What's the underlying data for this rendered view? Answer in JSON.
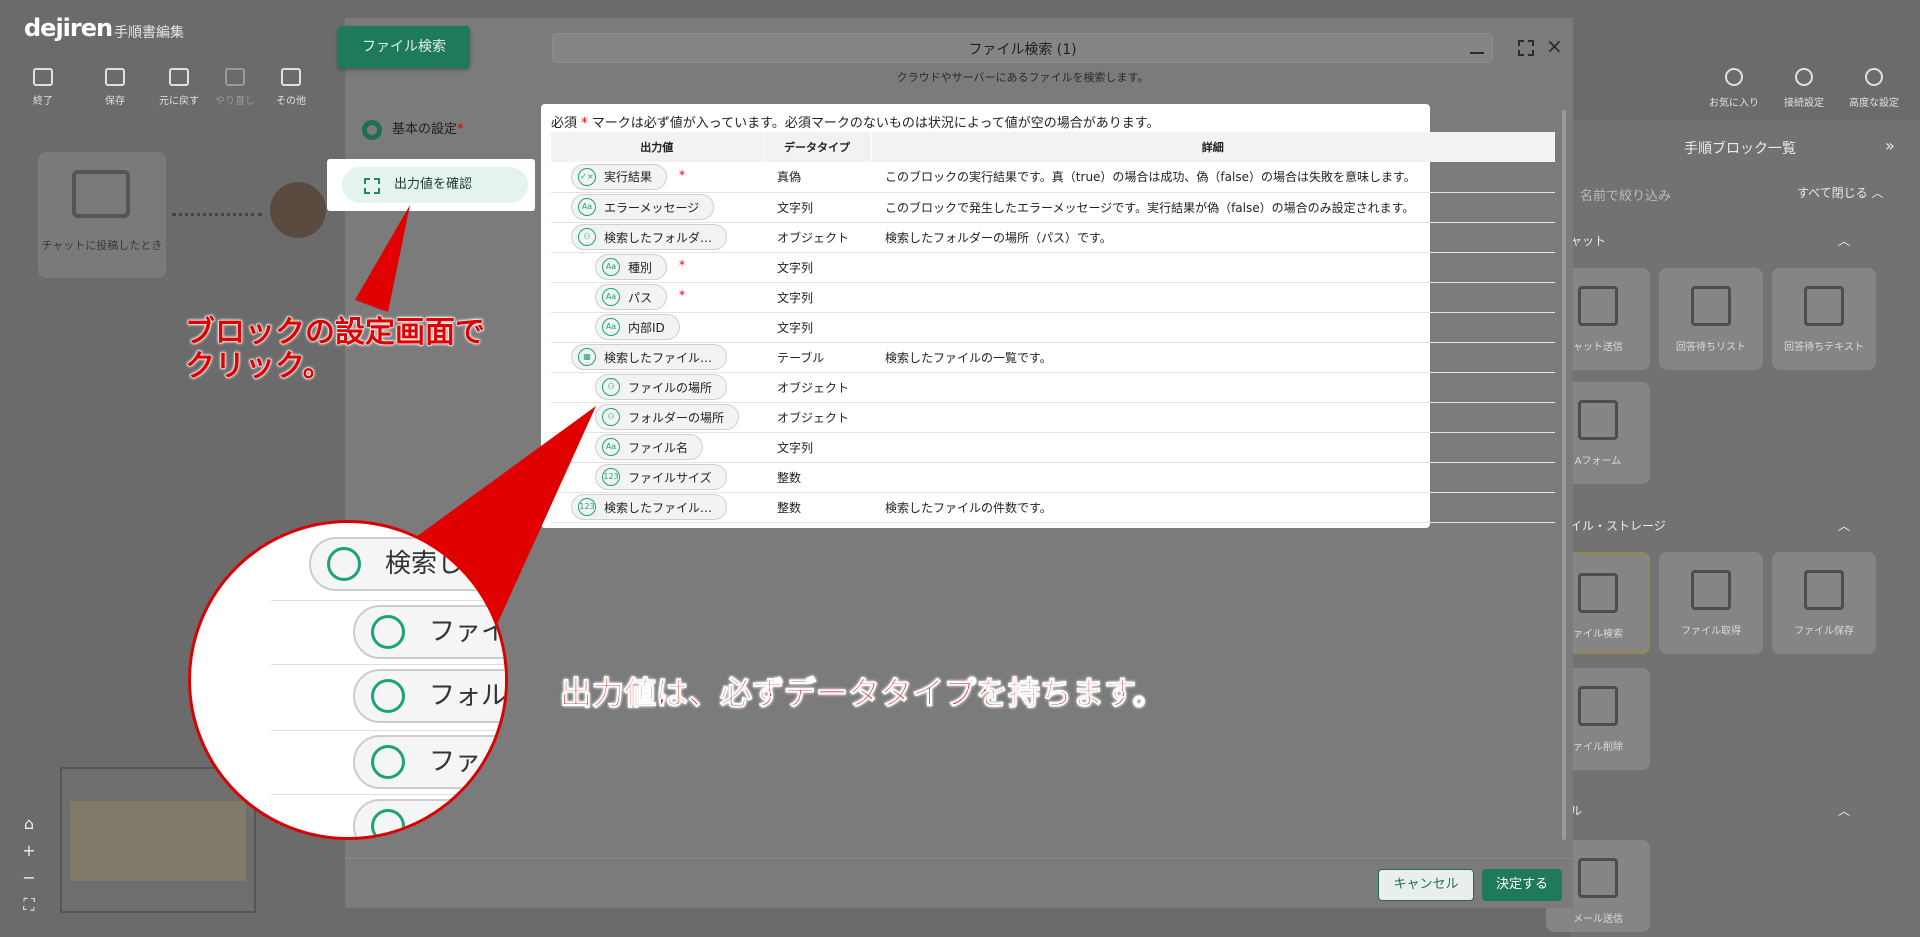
{
  "app": {
    "logo": "dejiren",
    "document_title": "手順書編集",
    "toolbar": [
      "終了",
      "保存",
      "元に戻す",
      "やり直し",
      "その他"
    ],
    "canvas_card_label": "チャットに投稿したとき",
    "right_tools": [
      "お気に入り",
      "接続設定",
      "高度な設定"
    ]
  },
  "right_panel": {
    "title": "手順ブロック一覧",
    "filter_placeholder": "名前で絞り込み",
    "close_all": "すべて閉じる",
    "sections": [
      {
        "label": "ャット",
        "cards": [
          "ャット送信",
          "回答待ちリスト",
          "回答待ちテキスト",
          "Aフォーム"
        ]
      },
      {
        "label": "イル・ストレージ",
        "cards": [
          "ァイル検索",
          "ファイル取得",
          "ファイル保存",
          "ァイル削除"
        ]
      },
      {
        "label": "ル",
        "cards": [
          "メール送信"
        ]
      }
    ]
  },
  "modal": {
    "block_tab": "ファイル検索",
    "title": "ファイル検索 (1)",
    "subtitle": "クラウドやサーバーにあるファイルを検索します。",
    "nav": {
      "basic": "基本の設定",
      "required_mark": "*",
      "output": "出力値を確認"
    },
    "buttons": {
      "cancel": "キャンセル",
      "ok": "決定する"
    }
  },
  "output_table": {
    "note_prefix": "必須",
    "note_star": "*",
    "note_suffix": "マークは必ず値が入っています。必須マークのないものは状況によって値が空の場合があります。",
    "headers": [
      "出力値",
      "データタイプ",
      "詳細"
    ],
    "rows": [
      {
        "name": "実行結果",
        "icon": "boolean-icon",
        "glyph": "✓×",
        "required": true,
        "indent": 0,
        "type": "真偽",
        "detail": "このブロックの実行結果です。真（true）の場合は成功、偽（false）の場合は失敗を意味します。"
      },
      {
        "name": "エラーメッセージ",
        "icon": "text-icon",
        "glyph": "Aa",
        "required": false,
        "indent": 0,
        "type": "文字列",
        "detail": "このブロックで発生したエラーメッセージです。実行結果が偽（false）の場合のみ設定されます。"
      },
      {
        "name": "検索したフォルダ…",
        "icon": "object-icon",
        "glyph": "⚇",
        "required": false,
        "indent": 0,
        "type": "オブジェクト",
        "detail": "検索したフォルダーの場所（パス）です。"
      },
      {
        "name": "種別",
        "icon": "text-icon",
        "glyph": "Aa",
        "required": true,
        "indent": 1,
        "type": "文字列",
        "detail": ""
      },
      {
        "name": "パス",
        "icon": "text-icon",
        "glyph": "Aa",
        "required": true,
        "indent": 1,
        "type": "文字列",
        "detail": ""
      },
      {
        "name": "内部ID",
        "icon": "text-icon",
        "glyph": "Aa",
        "required": false,
        "indent": 1,
        "type": "文字列",
        "detail": ""
      },
      {
        "name": "検索したファイル…",
        "icon": "table-icon",
        "glyph": "▦",
        "required": false,
        "indent": 0,
        "type": "テーブル",
        "detail": "検索したファイルの一覧です。"
      },
      {
        "name": "ファイルの場所",
        "icon": "object-icon",
        "glyph": "⚇",
        "required": false,
        "indent": 1,
        "type": "オブジェクト",
        "detail": ""
      },
      {
        "name": "フォルダーの場所",
        "icon": "object-icon",
        "glyph": "⚇",
        "required": false,
        "indent": 1,
        "type": "オブジェクト",
        "detail": ""
      },
      {
        "name": "ファイル名",
        "icon": "text-icon",
        "glyph": "Aa",
        "required": false,
        "indent": 1,
        "type": "文字列",
        "detail": ""
      },
      {
        "name": "ファイルサイズ",
        "icon": "number-icon",
        "glyph": "123",
        "required": false,
        "indent": 1,
        "type": "整数",
        "detail": ""
      },
      {
        "name": "検索したファイル…",
        "icon": "number-icon",
        "glyph": "123",
        "required": false,
        "indent": 0,
        "type": "整数",
        "detail": "検索したファイルの件数です。"
      }
    ]
  },
  "annotations": {
    "click_note_line1": "ブロックの設定画面で",
    "click_note_line2": "クリック。",
    "datatype_note": "出力値は、必ずデータタイプを持ちます。",
    "zoom_rows": [
      "検索し",
      "ファイ",
      "フォル",
      "ファイ",
      "フ"
    ]
  },
  "colors": {
    "accent": "#1f7a5c",
    "annotation": "#e00000",
    "required": "#dd0000"
  }
}
